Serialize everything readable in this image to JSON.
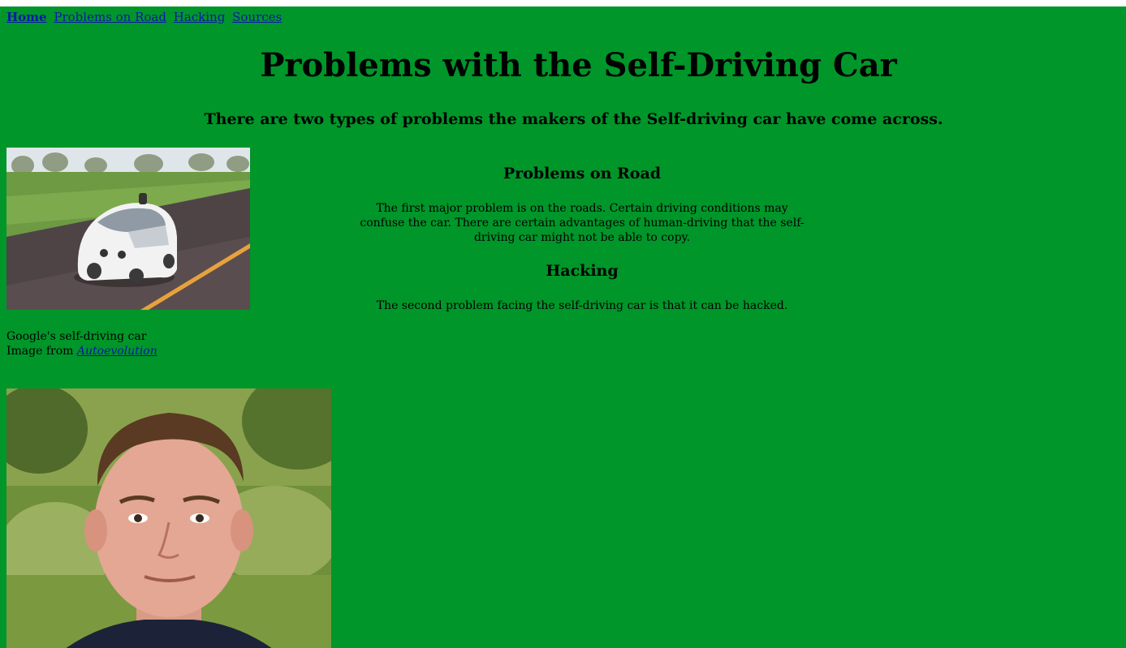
{
  "nav": {
    "items": [
      {
        "label": "Home"
      },
      {
        "label": "Problems on Road"
      },
      {
        "label": "Hacking"
      },
      {
        "label": "Sources"
      }
    ]
  },
  "page": {
    "title": "Problems with the Self-Driving Car",
    "subtitle": "There are two types of problems the makers of the Self-driving car have come across.",
    "background": "#00962a"
  },
  "sections": [
    {
      "heading": "Problems on Road",
      "text": "The first major problem is on the roads. Certain driving conditions may confuse the car. There are certain advantages of human-driving that the self-driving car might not be able to copy."
    },
    {
      "heading": "Hacking",
      "text": "The second problem facing the self-driving car is that it can be hacked."
    }
  ],
  "car_image": {
    "caption": "Google's self-driving car",
    "credit_prefix": "Image from",
    "credit_link": "Autoevolution"
  }
}
